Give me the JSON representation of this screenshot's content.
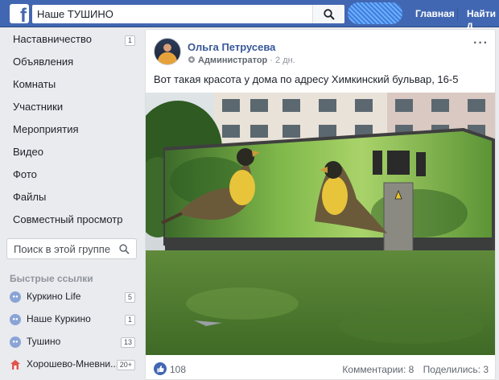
{
  "topbar": {
    "logo": "f",
    "search_value": "Наше ТУШИНО",
    "nav": [
      "Главная",
      "Найти д"
    ]
  },
  "sidebar": {
    "items": [
      {
        "label": "Наставничество",
        "badge": "1"
      },
      {
        "label": "Объявления"
      },
      {
        "label": "Комнаты"
      },
      {
        "label": "Участники"
      },
      {
        "label": "Мероприятия"
      },
      {
        "label": "Видео"
      },
      {
        "label": "Фото"
      },
      {
        "label": "Файлы"
      },
      {
        "label": "Совместный просмотр"
      }
    ],
    "group_search_placeholder": "Поиск в этой группе",
    "quick_links_title": "Быстрые ссылки",
    "quick_links": [
      {
        "label": "Куркино Life",
        "badge": "5",
        "icon": "group-icon"
      },
      {
        "label": "Наше Куркино",
        "badge": "1",
        "icon": "group-icon"
      },
      {
        "label": "Тушино",
        "badge": "13",
        "icon": "group-icon"
      },
      {
        "label": "Хорошево-Мневни...",
        "badge": "20+",
        "icon": "house-icon"
      }
    ]
  },
  "post": {
    "author": "Ольга Петрусева",
    "role": "Администратор",
    "time": "2 дн.",
    "text": "Вот такая красота у дома по адресу Химкинский бульвар, 16-5",
    "likes": "108",
    "comments": "Комментарии: 8",
    "shares": "Поделились: 3"
  },
  "colors": {
    "topbar": "#4267b2",
    "link": "#385898",
    "page_bg": "#e9ebee"
  }
}
